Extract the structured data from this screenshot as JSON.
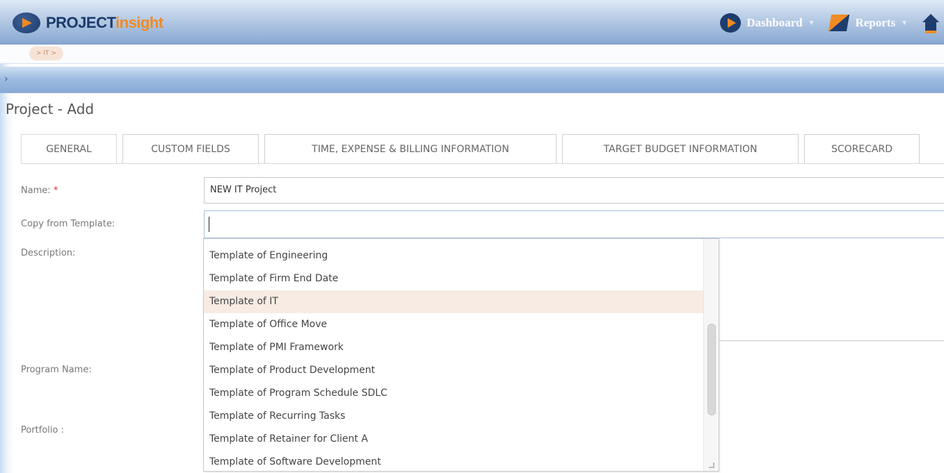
{
  "header": {
    "logo_project": "PROJECT",
    "logo_insight": "insight",
    "nav": [
      {
        "label": "Dashboard",
        "icon": "dashboard-icon"
      },
      {
        "label": "Reports",
        "icon": "reports-icon"
      }
    ],
    "home_icon": "home-icon"
  },
  "breadcrumb": "> IT >",
  "page": {
    "title": "Project - Add"
  },
  "tabs": [
    {
      "label": "GENERAL",
      "active": true
    },
    {
      "label": "CUSTOM FIELDS",
      "active": false
    },
    {
      "label": "TIME, EXPENSE & BILLING INFORMATION",
      "active": false
    },
    {
      "label": "TARGET BUDGET INFORMATION",
      "active": false
    },
    {
      "label": "SCORECARD",
      "active": false
    }
  ],
  "form": {
    "name_label": "Name:",
    "required_mark": "*",
    "name_value": "NEW IT Project",
    "copy_label": "Copy from Template:",
    "copy_value": "",
    "description_label": "Description:",
    "program_label": "Program Name:",
    "portfolio_label": "Portfolio :"
  },
  "template_dropdown": {
    "items": [
      "Template of Engineering",
      "Template of Firm End Date",
      "Template of IT",
      "Template of Office Move",
      "Template of PMI Framework",
      "Template of Product Development",
      "Template of Program Schedule SDLC",
      "Template of Recurring Tasks",
      "Template of Retainer for Client A",
      "Template of Software Development"
    ],
    "highlighted": "Template of IT"
  },
  "colors": {
    "brand_navy": "#1e3d6e",
    "brand_orange": "#f08a24",
    "highlight_row": "#f7ebe4",
    "header_blue": "#88a8d2"
  }
}
